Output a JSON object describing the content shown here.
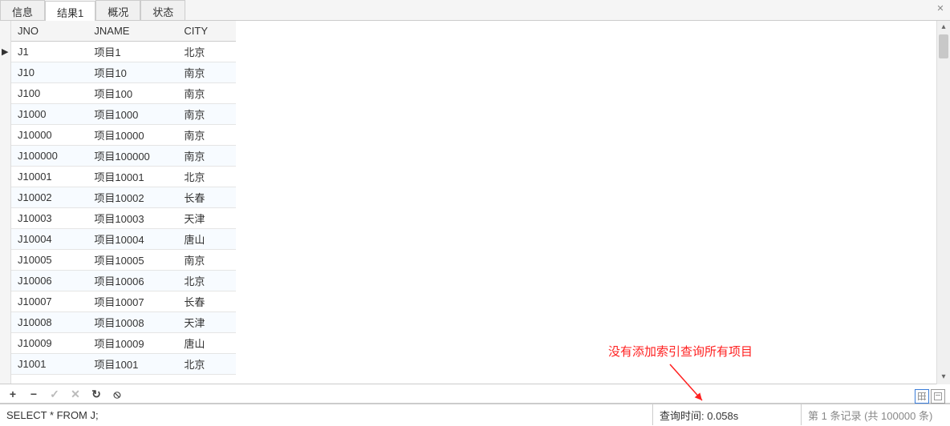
{
  "tabs": {
    "items": [
      "信息",
      "结果1",
      "概况",
      "状态"
    ],
    "active_index": 1
  },
  "columns": {
    "jno": "JNO",
    "jname": "JNAME",
    "city": "CITY"
  },
  "rows": [
    {
      "jno": "J1",
      "jname": "项目1",
      "city": "北京"
    },
    {
      "jno": "J10",
      "jname": "项目10",
      "city": "南京"
    },
    {
      "jno": "J100",
      "jname": "项目100",
      "city": "南京"
    },
    {
      "jno": "J1000",
      "jname": "项目1000",
      "city": "南京"
    },
    {
      "jno": "J10000",
      "jname": "项目10000",
      "city": "南京"
    },
    {
      "jno": "J100000",
      "jname": "项目100000",
      "city": "南京"
    },
    {
      "jno": "J10001",
      "jname": "项目10001",
      "city": "北京"
    },
    {
      "jno": "J10002",
      "jname": "项目10002",
      "city": "长春"
    },
    {
      "jno": "J10003",
      "jname": "项目10003",
      "city": "天津"
    },
    {
      "jno": "J10004",
      "jname": "项目10004",
      "city": "唐山"
    },
    {
      "jno": "J10005",
      "jname": "项目10005",
      "city": "南京"
    },
    {
      "jno": "J10006",
      "jname": "项目10006",
      "city": "北京"
    },
    {
      "jno": "J10007",
      "jname": "项目10007",
      "city": "长春"
    },
    {
      "jno": "J10008",
      "jname": "项目10008",
      "city": "天津"
    },
    {
      "jno": "J10009",
      "jname": "项目10009",
      "city": "唐山"
    },
    {
      "jno": "J1001",
      "jname": "项目1001",
      "city": "北京"
    }
  ],
  "toolbar": {
    "add": "+",
    "remove": "−",
    "commit": "✓",
    "cancel": "✕",
    "refresh": "↻",
    "stop": "⦸"
  },
  "status": {
    "sql": "SELECT * FROM J;",
    "query_time": "查询时间: 0.058s",
    "record_info": "第 1 条记录 (共 100000 条)"
  },
  "annotation": "没有添加索引查询所有项目",
  "close_x": "✕"
}
